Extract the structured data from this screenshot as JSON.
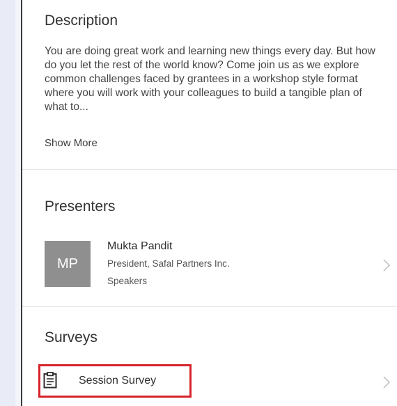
{
  "description": {
    "title": "Description",
    "body": "You are doing great work and learning new things every day. But how do you let the rest of the world know? Come join us as we explore common challenges faced by grantees in a workshop style format where you will work with your colleagues to build a tangible plan of what to...",
    "show_more": "Show More"
  },
  "presenters": {
    "title": "Presenters",
    "items": [
      {
        "initials": "MP",
        "name": "Mukta Pandit",
        "role": "President, Safal Partners Inc.",
        "category": "Speakers",
        "avatar_color": "#8f8f8f",
        "icon": "chevron-right-icon"
      }
    ]
  },
  "surveys": {
    "title": "Surveys",
    "items": [
      {
        "label": "Session Survey",
        "icon": "clipboard-icon",
        "highlight_color": "#d7232b"
      }
    ]
  }
}
